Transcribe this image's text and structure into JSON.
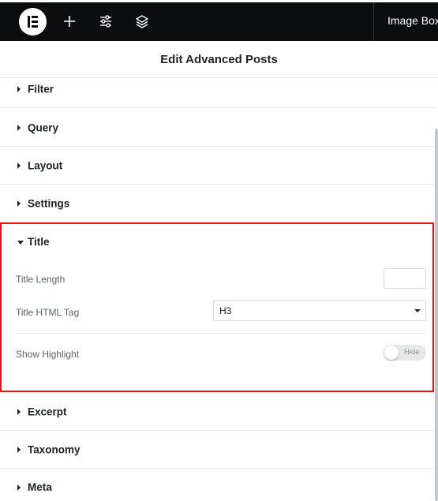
{
  "topbar": {
    "logo_icon": "elementor-logo-icon",
    "icons": [
      "plus-icon",
      "sliders-icon",
      "layers-icon"
    ],
    "page_name": "Image Box"
  },
  "panel": {
    "title": "Edit Advanced Posts"
  },
  "sections": {
    "filter": "Filter",
    "query": "Query",
    "layout": "Layout",
    "settings": "Settings",
    "title": "Title",
    "excerpt": "Excerpt",
    "taxonomy": "Taxonomy",
    "meta": "Meta"
  },
  "title_controls": {
    "title_length_label": "Title Length",
    "title_length_value": "",
    "title_html_tag_label": "Title HTML Tag",
    "title_html_tag_value": "H3",
    "show_highlight_label": "Show Highlight",
    "show_highlight_toggle_text": "Hide"
  },
  "colors": {
    "topbar_bg": "#0c0d0e",
    "highlight_border": "#e3111b"
  }
}
